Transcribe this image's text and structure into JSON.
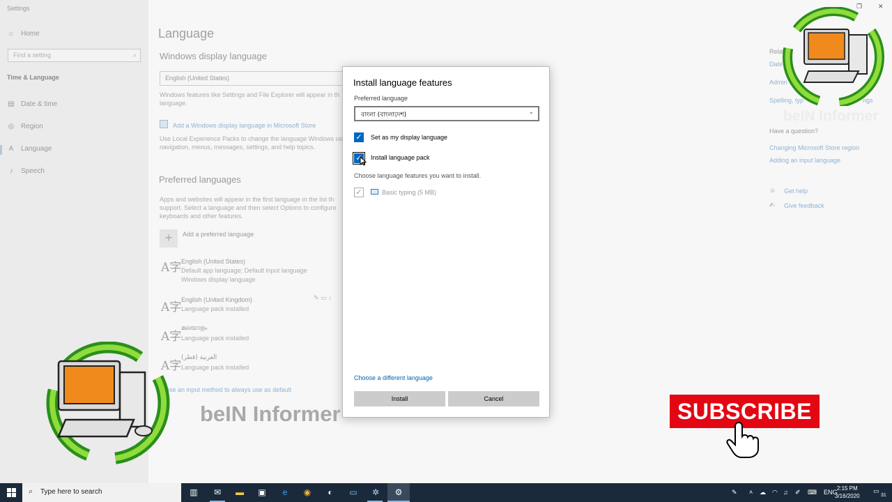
{
  "window": {
    "title": "Settings"
  },
  "sidebar": {
    "home": "Home",
    "search_placeholder": "Find a setting",
    "section": "Time & Language",
    "items": [
      {
        "label": "Date & time",
        "icon": "calendar-icon"
      },
      {
        "label": "Region",
        "icon": "globe-icon"
      },
      {
        "label": "Language",
        "icon": "language-icon"
      },
      {
        "label": "Speech",
        "icon": "microphone-icon"
      }
    ]
  },
  "main": {
    "title": "Language",
    "display_heading": "Windows display language",
    "display_value": "English (United States)",
    "display_desc_1": "Windows features like Settings and File Explorer will appear in th",
    "display_desc_2": "language.",
    "store_link": "Add a Windows display language in Microsoft Store",
    "lxp_desc_1": "Use Local Experience Packs to change the language Windows us",
    "lxp_desc_2": "navigation, menus, messages, settings, and help topics.",
    "preferred_heading": "Preferred languages",
    "pref_desc_1": "Apps and websites will appear in the first language in the list th",
    "pref_desc_2": "support. Select a language and then select Options to configure",
    "pref_desc_3": "keyboards and other features.",
    "add_preferred": "Add a preferred language",
    "languages": [
      {
        "name": "English (United States)",
        "line1": "Default app language; Default input language",
        "line2": "Windows display language"
      },
      {
        "name": "English (United Kingdom)",
        "line1": "Language pack installed"
      },
      {
        "name": "മലയാളം",
        "line1": "Language pack installed"
      },
      {
        "name": "العربية (قطر)",
        "line1": "Language pack installed"
      }
    ],
    "input_method_link": "oose an input method to always use as default"
  },
  "right": {
    "related_partial": "Relat",
    "date_partial": "Date",
    "admin_partial": "Admin",
    "spelling_partial": "Spelling, typ",
    "spelling_end": "ngs",
    "question_heading": "Have a question?",
    "q_link_1": "Changing Microsoft Store region",
    "q_link_2": "Adding an input language",
    "get_help": "Get help",
    "give_feedback": "Give feedback"
  },
  "dialog": {
    "title": "Install language features",
    "preferred_label": "Preferred language",
    "selected_language": "বাংলা (বাংলাদেশ)",
    "set_display": "Set as my display language",
    "install_pack": "Install language pack",
    "choose_features": "Choose language features you want to install.",
    "basic_typing": "Basic typing (5 MB)",
    "different_link": "Choose a different language",
    "install_button": "Install",
    "cancel_button": "Cancel"
  },
  "overlay": {
    "watermark_text": "beIN Informer",
    "subscribe_label": "SUBSCRIBE"
  },
  "taskbar": {
    "search_placeholder": "Type here to search",
    "lang": "ENG",
    "time": "2:15 PM",
    "date": "3/16/2020",
    "notification_count": "31"
  },
  "colors": {
    "accent": "#0067c0",
    "link": "#0063b1",
    "subscribe_red": "#e30613",
    "taskbar": "#1b2a3a"
  }
}
